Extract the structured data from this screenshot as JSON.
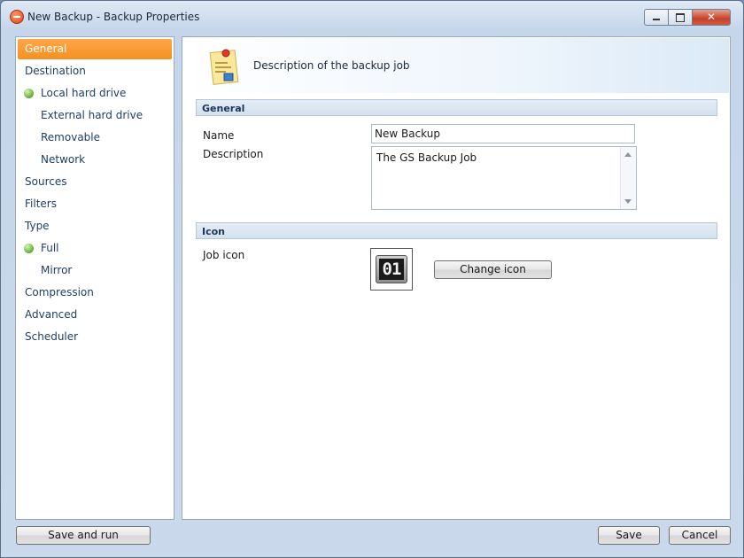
{
  "window": {
    "title": "New Backup - Backup Properties",
    "minimize_glyph": "",
    "close_glyph": "✕"
  },
  "sidebar": {
    "items": [
      {
        "label": "General",
        "selected": true
      },
      {
        "label": "Destination"
      },
      {
        "label": "Local hard drive",
        "sub": true,
        "bullet": true
      },
      {
        "label": "External hard drive",
        "sub": true
      },
      {
        "label": "Removable",
        "sub": true
      },
      {
        "label": "Network",
        "sub": true
      },
      {
        "label": "Sources"
      },
      {
        "label": "Filters"
      },
      {
        "label": "Type"
      },
      {
        "label": "Full",
        "sub": true,
        "bullet": true
      },
      {
        "label": "Mirror",
        "sub": true
      },
      {
        "label": "Compression"
      },
      {
        "label": "Advanced"
      },
      {
        "label": "Scheduler"
      }
    ]
  },
  "main": {
    "header_text": "Description of the backup job",
    "general_section": "General",
    "name_label": "Name",
    "name_value": "New Backup",
    "description_label": "Description",
    "description_value": "The GS Backup Job",
    "icon_section": "Icon",
    "job_icon_label": "Job icon",
    "job_icon_digits": "01",
    "change_icon_label": "Change icon"
  },
  "footer": {
    "save_and_run_label": "Save and run",
    "save_label": "Save",
    "cancel_label": "Cancel"
  },
  "colors": {
    "selected_item": "#f39221",
    "nav_text": "#1e3f66",
    "status_bullet": "#5fae2c"
  }
}
